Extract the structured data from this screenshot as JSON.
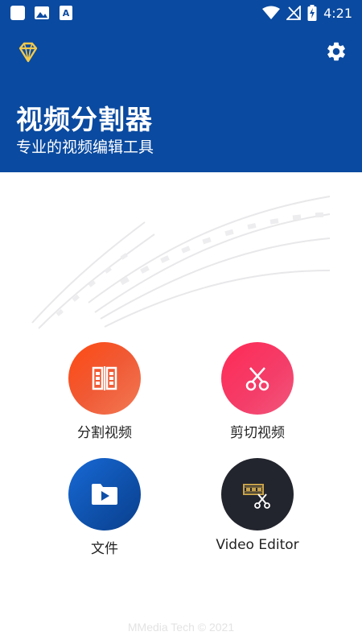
{
  "status_bar": {
    "time": "4:21",
    "left_icons": [
      "square-notification-icon",
      "image-notification-icon",
      "font-notification-icon"
    ],
    "right_icons": [
      "wifi-icon",
      "no-signal-icon",
      "battery-charging-icon"
    ]
  },
  "header": {
    "title": "视频分割器",
    "subtitle": "专业的视频编辑工具",
    "background": "#0a4aa0",
    "left_icon": "diamond-icon",
    "right_icon": "gear-icon"
  },
  "actions": [
    {
      "label": "分割视频",
      "icon": "split-icon",
      "color": "#ff4a12"
    },
    {
      "label": "剪切视频",
      "icon": "scissors-icon",
      "color": "#ff2a55"
    },
    {
      "label": "文件",
      "icon": "video-folder-icon",
      "color": "#1769d6"
    },
    {
      "label": "Video Editor",
      "icon": "film-scissors-icon",
      "color": "#23252e"
    }
  ],
  "footer": {
    "text": "MMedia Tech © 2021"
  }
}
